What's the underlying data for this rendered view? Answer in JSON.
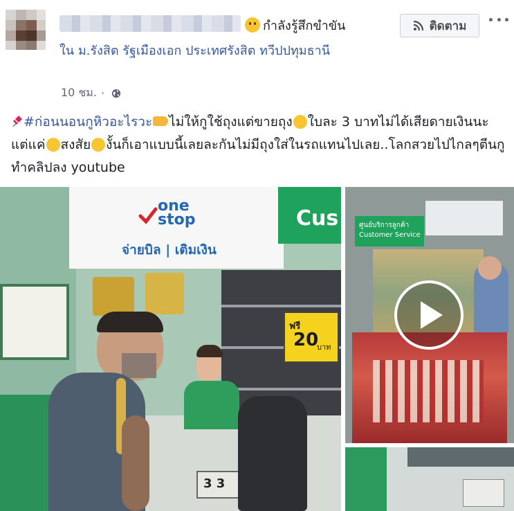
{
  "header": {
    "feeling": "กำลังรู้สึกขำขัน",
    "location": "ใน ม.รังสิต รัฐเมืองเอก ประเทศรังสิต ทวีปปทุมธานี",
    "time": "10 ชม.",
    "follow_label": "ติดตาม"
  },
  "post": {
    "hashtag": "#ก่อนนอนกูหิวอะไรวะ",
    "seg1": "ไม่ให้กูใช้ถุงแต่ขายถุง",
    "seg2": "ใบละ 3 บาทไม่ได้เสียดายเงินนะแต่แค่",
    "seg3": "สงสัย",
    "seg4": "งั้นก็เอาแบบนี้เลยละกันไม่มีถุงใส่ในรถแทนไปเลย..โลกสวยไปไกลๆตีนกูทำคลิปลง youtube"
  },
  "photo_main": {
    "sign_brand_line1": "one",
    "sign_brand_line2": "stop",
    "sign_service": "จ่ายบิล | เติมเงิน",
    "sign_partial": "Cus",
    "price_tag_label": "ฟรี",
    "price_tag_value": "20",
    "price_tag_sub": "บาท",
    "register_number": "3 3"
  },
  "photo_video": {
    "sign_line1": "ศูนย์บริการลูกค้า",
    "sign_line2": "Customer Service"
  },
  "colors": {
    "link": "#385898",
    "store_green": "#2e8b57",
    "wall_teal": "#9fc5b4"
  }
}
